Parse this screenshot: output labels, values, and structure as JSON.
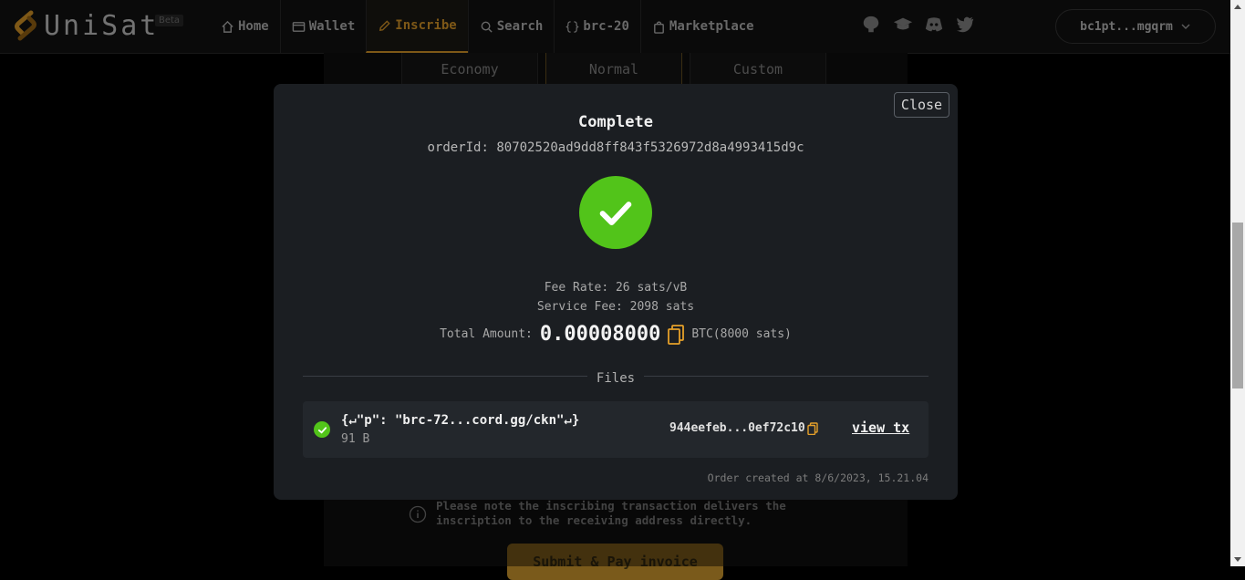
{
  "brand": {
    "name": "UniSat",
    "badge": "Beta"
  },
  "nav": {
    "items": [
      {
        "label": "Home",
        "icon": "home-icon"
      },
      {
        "label": "Wallet",
        "icon": "wallet-icon"
      },
      {
        "label": "Inscribe",
        "icon": "pencil-icon",
        "active": true
      },
      {
        "label": "Search",
        "icon": "search-icon"
      },
      {
        "label": "brc-20",
        "icon": "braces-icon"
      },
      {
        "label": "Marketplace",
        "icon": "bag-icon"
      }
    ],
    "social": [
      "github-icon",
      "graduation-cap-icon",
      "discord-icon",
      "twitter-icon"
    ],
    "wallet_address": "bc1pt...mgqrm"
  },
  "background": {
    "fee_tabs": [
      "Economy",
      "Normal",
      "Custom"
    ],
    "note": "Please note the inscribing transaction delivers the inscription to the receiving address directly.",
    "submit_label": "Submit & Pay invoice"
  },
  "modal": {
    "close_label": "Close",
    "title": "Complete",
    "order_id": "orderId: 80702520ad9dd8ff843f5326972d8a4993415d9c",
    "fee_rate": "Fee Rate: 26 sats/vB",
    "service_fee": "Service Fee: 2098 sats",
    "total_label": "Total Amount:",
    "total_amount": "0.00008000",
    "total_unit": "BTC(8000 sats)",
    "files_label": "Files",
    "file": {
      "name": "{↵\"p\": \"brc-72...cord.gg/ckn\"↵}",
      "size": "91 B",
      "txid": "944eefeb...0ef72c10",
      "view_label": "view tx"
    },
    "order_created": "Order created at 8/6/2023, 15.21.04"
  },
  "colors": {
    "accent": "#e5a02a",
    "success": "#52c41a",
    "modal_bg": "#1b1e22"
  }
}
